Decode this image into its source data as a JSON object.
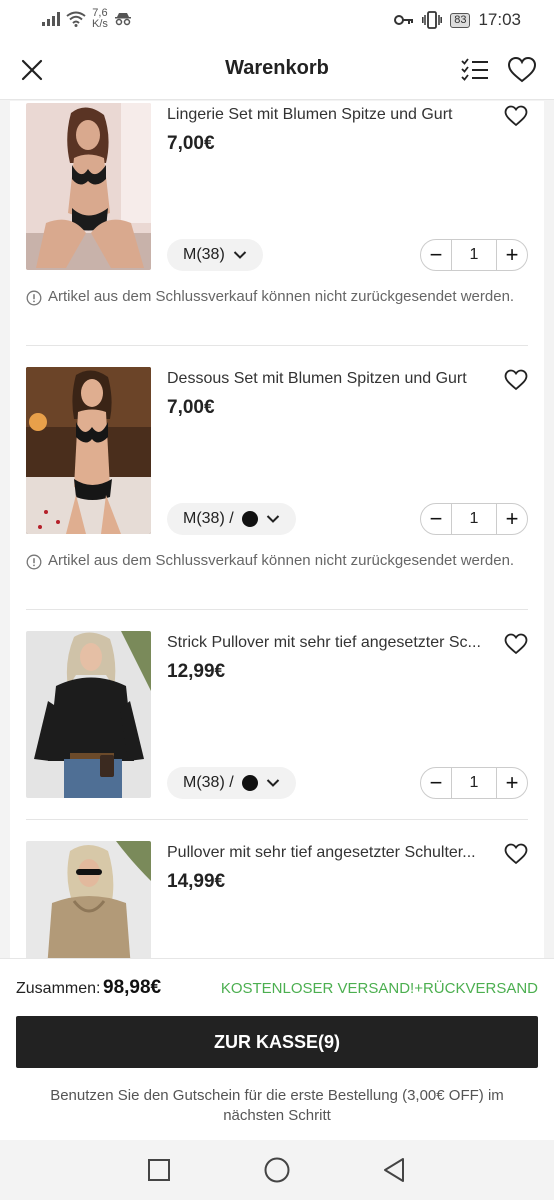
{
  "status_bar": {
    "net_speed_value": "7,6",
    "net_speed_unit": "K/s",
    "battery": "83",
    "time": "17:03"
  },
  "header": {
    "title": "Warenkorb"
  },
  "items": [
    {
      "name": "Lingerie Set mit Blumen Spitze und Gurt",
      "price": "7,00€",
      "variant": "M(38)",
      "has_color": false,
      "quantity": "1",
      "notice": "Artikel aus dem Schlussverkauf können nicht zurückgesendet werden."
    },
    {
      "name": "Dessous Set mit Blumen Spitzen und Gurt",
      "price": "7,00€",
      "variant": "M(38) /",
      "has_color": true,
      "quantity": "1",
      "notice": "Artikel aus dem Schlussverkauf können nicht zurückgesendet werden."
    },
    {
      "name": "Strick Pullover mit sehr tief angesetzter Sc...",
      "price": "12,99€",
      "variant": "M(38) /",
      "has_color": true,
      "quantity": "1"
    },
    {
      "name": "Pullover mit sehr tief angesetzter Schulter...",
      "price": "14,99€"
    }
  ],
  "footer": {
    "total_label": "Zusammen:",
    "total_value": "98,98€",
    "shipping": "KOSTENLOSER VERSAND!+RÜCKVERSAND",
    "checkout_label": "ZUR KASSE(9)",
    "coupon_text": "Benutzen Sie den Gutschein für die erste Bestellung (3,00€ OFF) im nächsten Schritt"
  },
  "colors": {
    "accent_green": "#4caf50",
    "checkout_bg": "#222222"
  }
}
